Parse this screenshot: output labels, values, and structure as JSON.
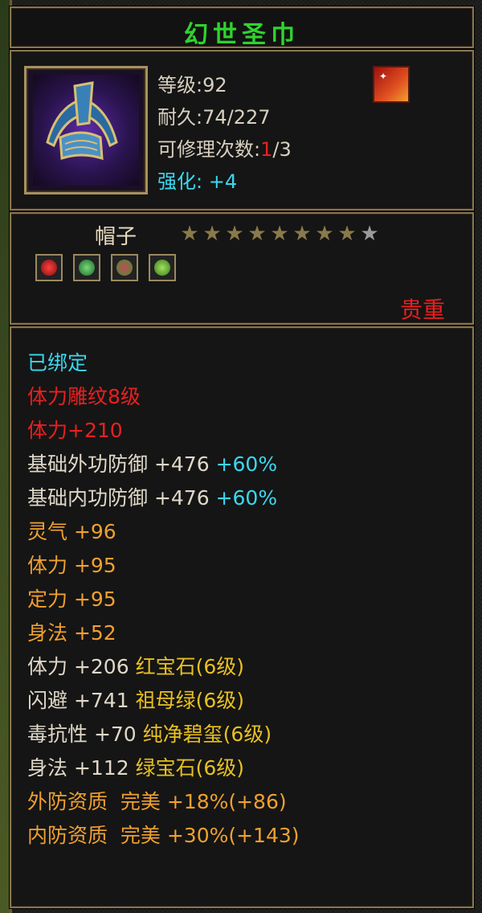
{
  "title": "幻世圣巾",
  "item": {
    "level_label": "等级:92",
    "durability_label": "耐久:74/227",
    "repair_prefix": "可修理次数:",
    "repair_used": "1",
    "repair_total": "/3",
    "enhance_label": "强化:",
    "enhance_value": "+4"
  },
  "category": "帽子",
  "stars": {
    "filled": 8,
    "total": 9
  },
  "rarity": "贵重",
  "colors": {
    "title": "#2ed42e",
    "red": "#e82020",
    "cyan": "#3ad8f0",
    "orange": "#f0a030",
    "yellow": "#e8c020",
    "white": "#e0d8c8"
  },
  "attributes": [
    {
      "text": "已绑定",
      "extra": "",
      "color": "cyan"
    },
    {
      "text": "体力雕纹8级",
      "extra": "",
      "color": "red"
    },
    {
      "text": "体力+210",
      "extra": "",
      "color": "red"
    },
    {
      "text": "基础外功防御 +476 ",
      "extra": "+60%",
      "color": "white",
      "extra_color": "cyan"
    },
    {
      "text": "基础内功防御 +476 ",
      "extra": "+60%",
      "color": "white",
      "extra_color": "cyan"
    },
    {
      "text": "灵气 +96",
      "extra": "",
      "color": "orange"
    },
    {
      "text": "体力 +95",
      "extra": "",
      "color": "orange"
    },
    {
      "text": "定力 +95",
      "extra": "",
      "color": "orange"
    },
    {
      "text": "身法 +52",
      "extra": "",
      "color": "orange"
    },
    {
      "text": "体力 +206 ",
      "extra": "红宝石(6级)",
      "color": "white",
      "extra_color": "yellow"
    },
    {
      "text": "闪避 +741 ",
      "extra": "祖母绿(6级)",
      "color": "white",
      "extra_color": "yellow"
    },
    {
      "text": "毒抗性 +70 ",
      "extra": "纯净碧玺(6级)",
      "color": "white",
      "extra_color": "yellow"
    },
    {
      "text": "身法 +112 ",
      "extra": "绿宝石(6级)",
      "color": "white",
      "extra_color": "yellow"
    },
    {
      "text": "外防资质  完美 +18%(+86)",
      "extra": "",
      "color": "orange"
    },
    {
      "text": "内防资质  完美 +30%(+143)",
      "extra": "",
      "color": "orange"
    }
  ],
  "icons": {
    "item": "hat-icon",
    "skill": "flame-skill-icon",
    "gems": [
      "ruby-gem-icon",
      "jade-gem-icon",
      "emerald-gem-icon",
      "peridot-gem-icon"
    ]
  }
}
